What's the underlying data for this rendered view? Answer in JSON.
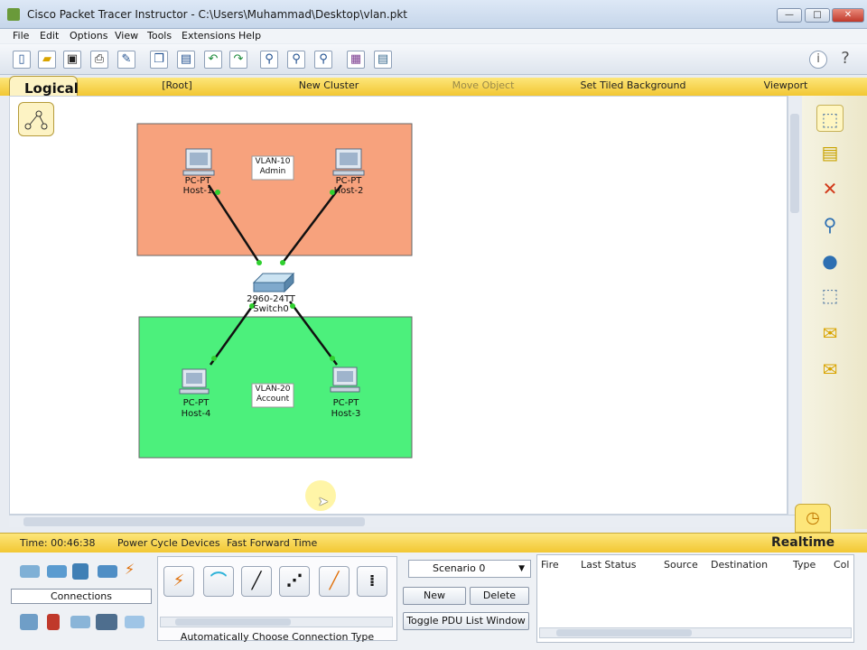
{
  "window": {
    "title": "Cisco Packet Tracer Instructor - C:\\Users\\Muhammad\\Desktop\\vlan.pkt",
    "minimize": "—",
    "maximize": "□",
    "close": "✕"
  },
  "menu": [
    "File",
    "Edit",
    "Options",
    "View",
    "Tools",
    "Extensions",
    "Help"
  ],
  "toolbar": {
    "icons": [
      "new-file-icon",
      "open-folder-icon",
      "save-icon",
      "print-icon",
      "activity-wizard-icon",
      "copy-icon",
      "paste-icon",
      "undo-icon",
      "redo-icon",
      "zoom-in-icon",
      "zoom-reset-icon",
      "zoom-out-icon",
      "drawing-palette-icon",
      "custom-device-icon",
      "info-icon",
      "help-icon"
    ]
  },
  "logical_bar": {
    "tab": "Logical",
    "root": "[Root]",
    "new_cluster": "New Cluster",
    "move_object": "Move Object",
    "set_tiled_background": "Set Tiled Background",
    "viewport": "Viewport"
  },
  "topology": {
    "vlan10": {
      "line1": "VLAN-10",
      "line2": "Admin",
      "color": "#f7a27d"
    },
    "vlan20": {
      "line1": "VLAN-20",
      "line2": "Account",
      "color": "#4cf07c"
    },
    "hosts": [
      {
        "type": "PC-PT",
        "name": "Host-1"
      },
      {
        "type": "PC-PT",
        "name": "Host-2"
      },
      {
        "type": "PC-PT",
        "name": "Host-4"
      },
      {
        "type": "PC-PT",
        "name": "Host-3"
      }
    ],
    "switch": {
      "model": "2960-24TT",
      "name": "Switch0"
    },
    "link_color": "#111111",
    "port_up_color": "#2fd02f"
  },
  "palette": [
    "select-icon",
    "note-icon",
    "delete-icon",
    "inspect-icon",
    "draw-shape-icon",
    "resize-icon",
    "add-simple-pdu-icon",
    "add-complex-pdu-icon"
  ],
  "status": {
    "time": "Time: 00:46:38",
    "power_cycle": "Power Cycle Devices",
    "fast_forward": "Fast Forward Time",
    "mode": "Realtime"
  },
  "device_panel": {
    "category_label": "Connections",
    "connection_types_label": "Automatically Choose Connection Type"
  },
  "scenario": {
    "selected": "Scenario 0",
    "new": "New",
    "delete": "Delete",
    "toggle": "Toggle PDU List Window"
  },
  "pdu_columns": [
    "Fire",
    "Last Status",
    "Source",
    "Destination",
    "Type",
    "Col"
  ]
}
